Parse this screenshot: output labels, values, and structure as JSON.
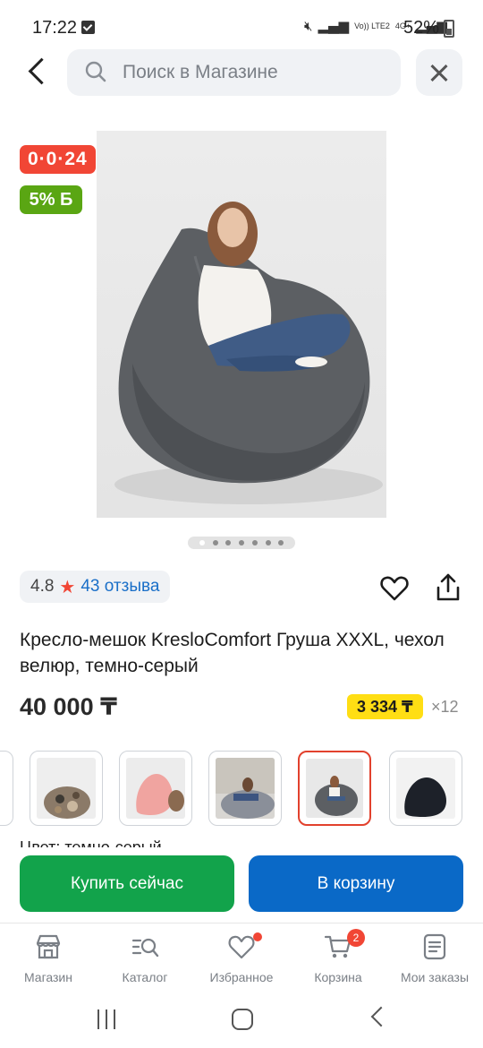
{
  "status_bar": {
    "time": "17:22",
    "network_volte": "Vo)) LTE2",
    "network_4g": "4G+",
    "battery": "52%"
  },
  "header": {
    "search_placeholder": "Поиск в Магазине"
  },
  "product": {
    "timer_badge": "0·0·24",
    "discount_badge": "5% Б",
    "gallery_dots_total": 7,
    "gallery_dot_active": 1,
    "rating": "4.8",
    "reviews": "43 отзыва",
    "title": "Кресло-мешок KresloComfort Груша XXXL, чехол велюр, темно-серый",
    "price": "40 000 ₸",
    "installment_price": "3 334 ₸",
    "installment_months": "×12",
    "color_caption": "Цвет: темно-серый"
  },
  "variants": [
    {
      "name": "variant-camouflage",
      "selected": false
    },
    {
      "name": "variant-pink",
      "selected": false
    },
    {
      "name": "variant-gray-light",
      "selected": false
    },
    {
      "name": "variant-dark-gray",
      "selected": true
    },
    {
      "name": "variant-black",
      "selected": false
    }
  ],
  "actions": {
    "buy_now": "Купить сейчас",
    "add_to_cart": "В корзину"
  },
  "bottom_nav": {
    "items": [
      {
        "label": "Магазин",
        "icon": "store-icon"
      },
      {
        "label": "Каталог",
        "icon": "catalog-icon"
      },
      {
        "label": "Избранное",
        "icon": "heart-icon"
      },
      {
        "label": "Корзина",
        "icon": "cart-icon",
        "badge": "2"
      },
      {
        "label": "Мои заказы",
        "icon": "orders-icon"
      }
    ]
  },
  "colors": {
    "accent_red": "#f14635",
    "green_button": "#12a34b",
    "blue_button": "#0a69c7",
    "installment_yellow": "#ffde14",
    "discount_green": "#5aa613"
  }
}
